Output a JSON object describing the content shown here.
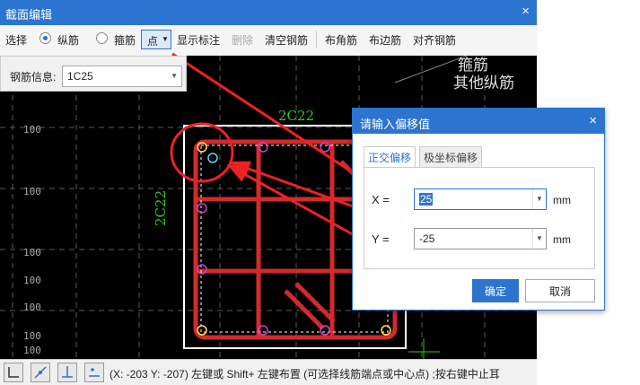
{
  "window": {
    "title": "截面编辑",
    "close": "×"
  },
  "toolbar": {
    "select": "选择",
    "radio_longitudinal": "纵筋",
    "radio_stirrup": "箍筋",
    "mode": "点",
    "show_label": "显示标注",
    "delete": "删除",
    "clear_rebar": "清空钢筋",
    "corner_rebar": "布角筋",
    "edge_rebar": "布边筋",
    "align_rebar": "对齐钢筋"
  },
  "rebar_info": {
    "label": "钢筋信息:",
    "value": "1C25"
  },
  "canvas": {
    "top_label": "2C22",
    "left_label": "2C22",
    "legend_line1": "箍筋",
    "legend_line2": "其他纵筋",
    "axis_values": [
      "100",
      "100",
      "100",
      "100",
      "100",
      "100",
      "100",
      "100",
      "100",
      "100"
    ]
  },
  "statusbar": {
    "text": "(X: -203 Y: -207) 左键或 Shift+ 左键布置 (可选择线筋端点或中心点) ;按右键中止耳"
  },
  "dialog": {
    "title": "请输入偏移值",
    "close": "×",
    "tab_ortho": "正交偏移",
    "tab_polar": "极坐标偏移",
    "x_label": "X =",
    "x_value": "25",
    "y_label": "Y =",
    "y_value": "-25",
    "unit": "mm",
    "ok": "确定",
    "cancel": "取消"
  },
  "colors": {
    "accent": "#2b74d0",
    "rebar": "#d42a2a",
    "annotation": "#ee2222",
    "label_green": "#22cc22"
  }
}
